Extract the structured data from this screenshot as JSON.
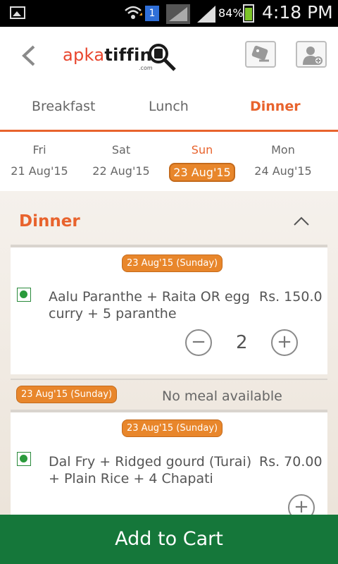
{
  "status_bar": {
    "sim_number": "1",
    "battery": "84%",
    "time": "4:18 PM"
  },
  "header": {
    "logo_left": "apka",
    "logo_right": "tiffin",
    "logo_suffix": ".com"
  },
  "meal_tabs": [
    "Breakfast",
    "Lunch",
    "Dinner"
  ],
  "active_meal_tab": "Dinner",
  "days": [
    {
      "day": "Fri",
      "date": "21 Aug'15"
    },
    {
      "day": "Sat",
      "date": "22 Aug'15"
    },
    {
      "day": "Sun",
      "date": "23 Aug'15"
    },
    {
      "day": "Mon",
      "date": "24 Aug'15"
    }
  ],
  "section": {
    "title": "Dinner"
  },
  "menu_cards": [
    {
      "date_badge": "23 Aug'15 (Sunday)",
      "item_line1": "Aalu Paranthe + Raita OR egg",
      "item_line2": "curry + 5 paranthe",
      "price": "Rs. 150.0",
      "quantity": "2",
      "minus": "−",
      "plus": "+"
    },
    {
      "date_badge": "23 Aug'15 (Sunday)",
      "item_line1": "Dal Fry + Ridged gourd (Turai)",
      "item_line2": "+ Plain Rice + 4 Chapati",
      "price": "Rs. 70.00",
      "plus": "+"
    }
  ],
  "no_meal": {
    "date_badge": "23 Aug'15 (Sunday)",
    "text": "No meal available"
  },
  "add_to_cart": "Add to Cart",
  "colors": {
    "accent": "#e8632d",
    "badge": "#e8862b",
    "cart": "#15773a",
    "veg": "#2a9a3b"
  }
}
